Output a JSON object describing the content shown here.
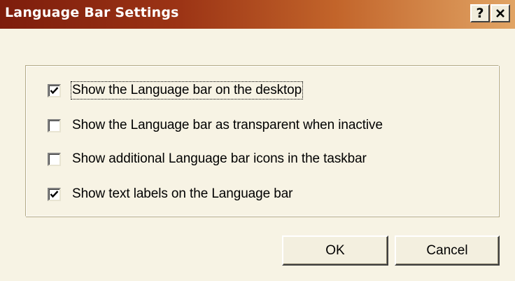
{
  "window": {
    "title": "Language Bar Settings",
    "help_label": "?",
    "close_label": "✕",
    "accent_start": "#7d1d0c",
    "accent_end": "#e1a464"
  },
  "options": [
    {
      "label": "Show the Language bar on the desktop",
      "checked": true,
      "focused": true
    },
    {
      "label": "Show the Language bar as transparent when inactive",
      "checked": false
    },
    {
      "label": "Show additional Language bar icons in the taskbar",
      "checked": false
    },
    {
      "label": "Show text labels on the Language bar",
      "checked": true
    }
  ],
  "buttons": {
    "ok_label": "OK",
    "cancel_label": "Cancel"
  }
}
